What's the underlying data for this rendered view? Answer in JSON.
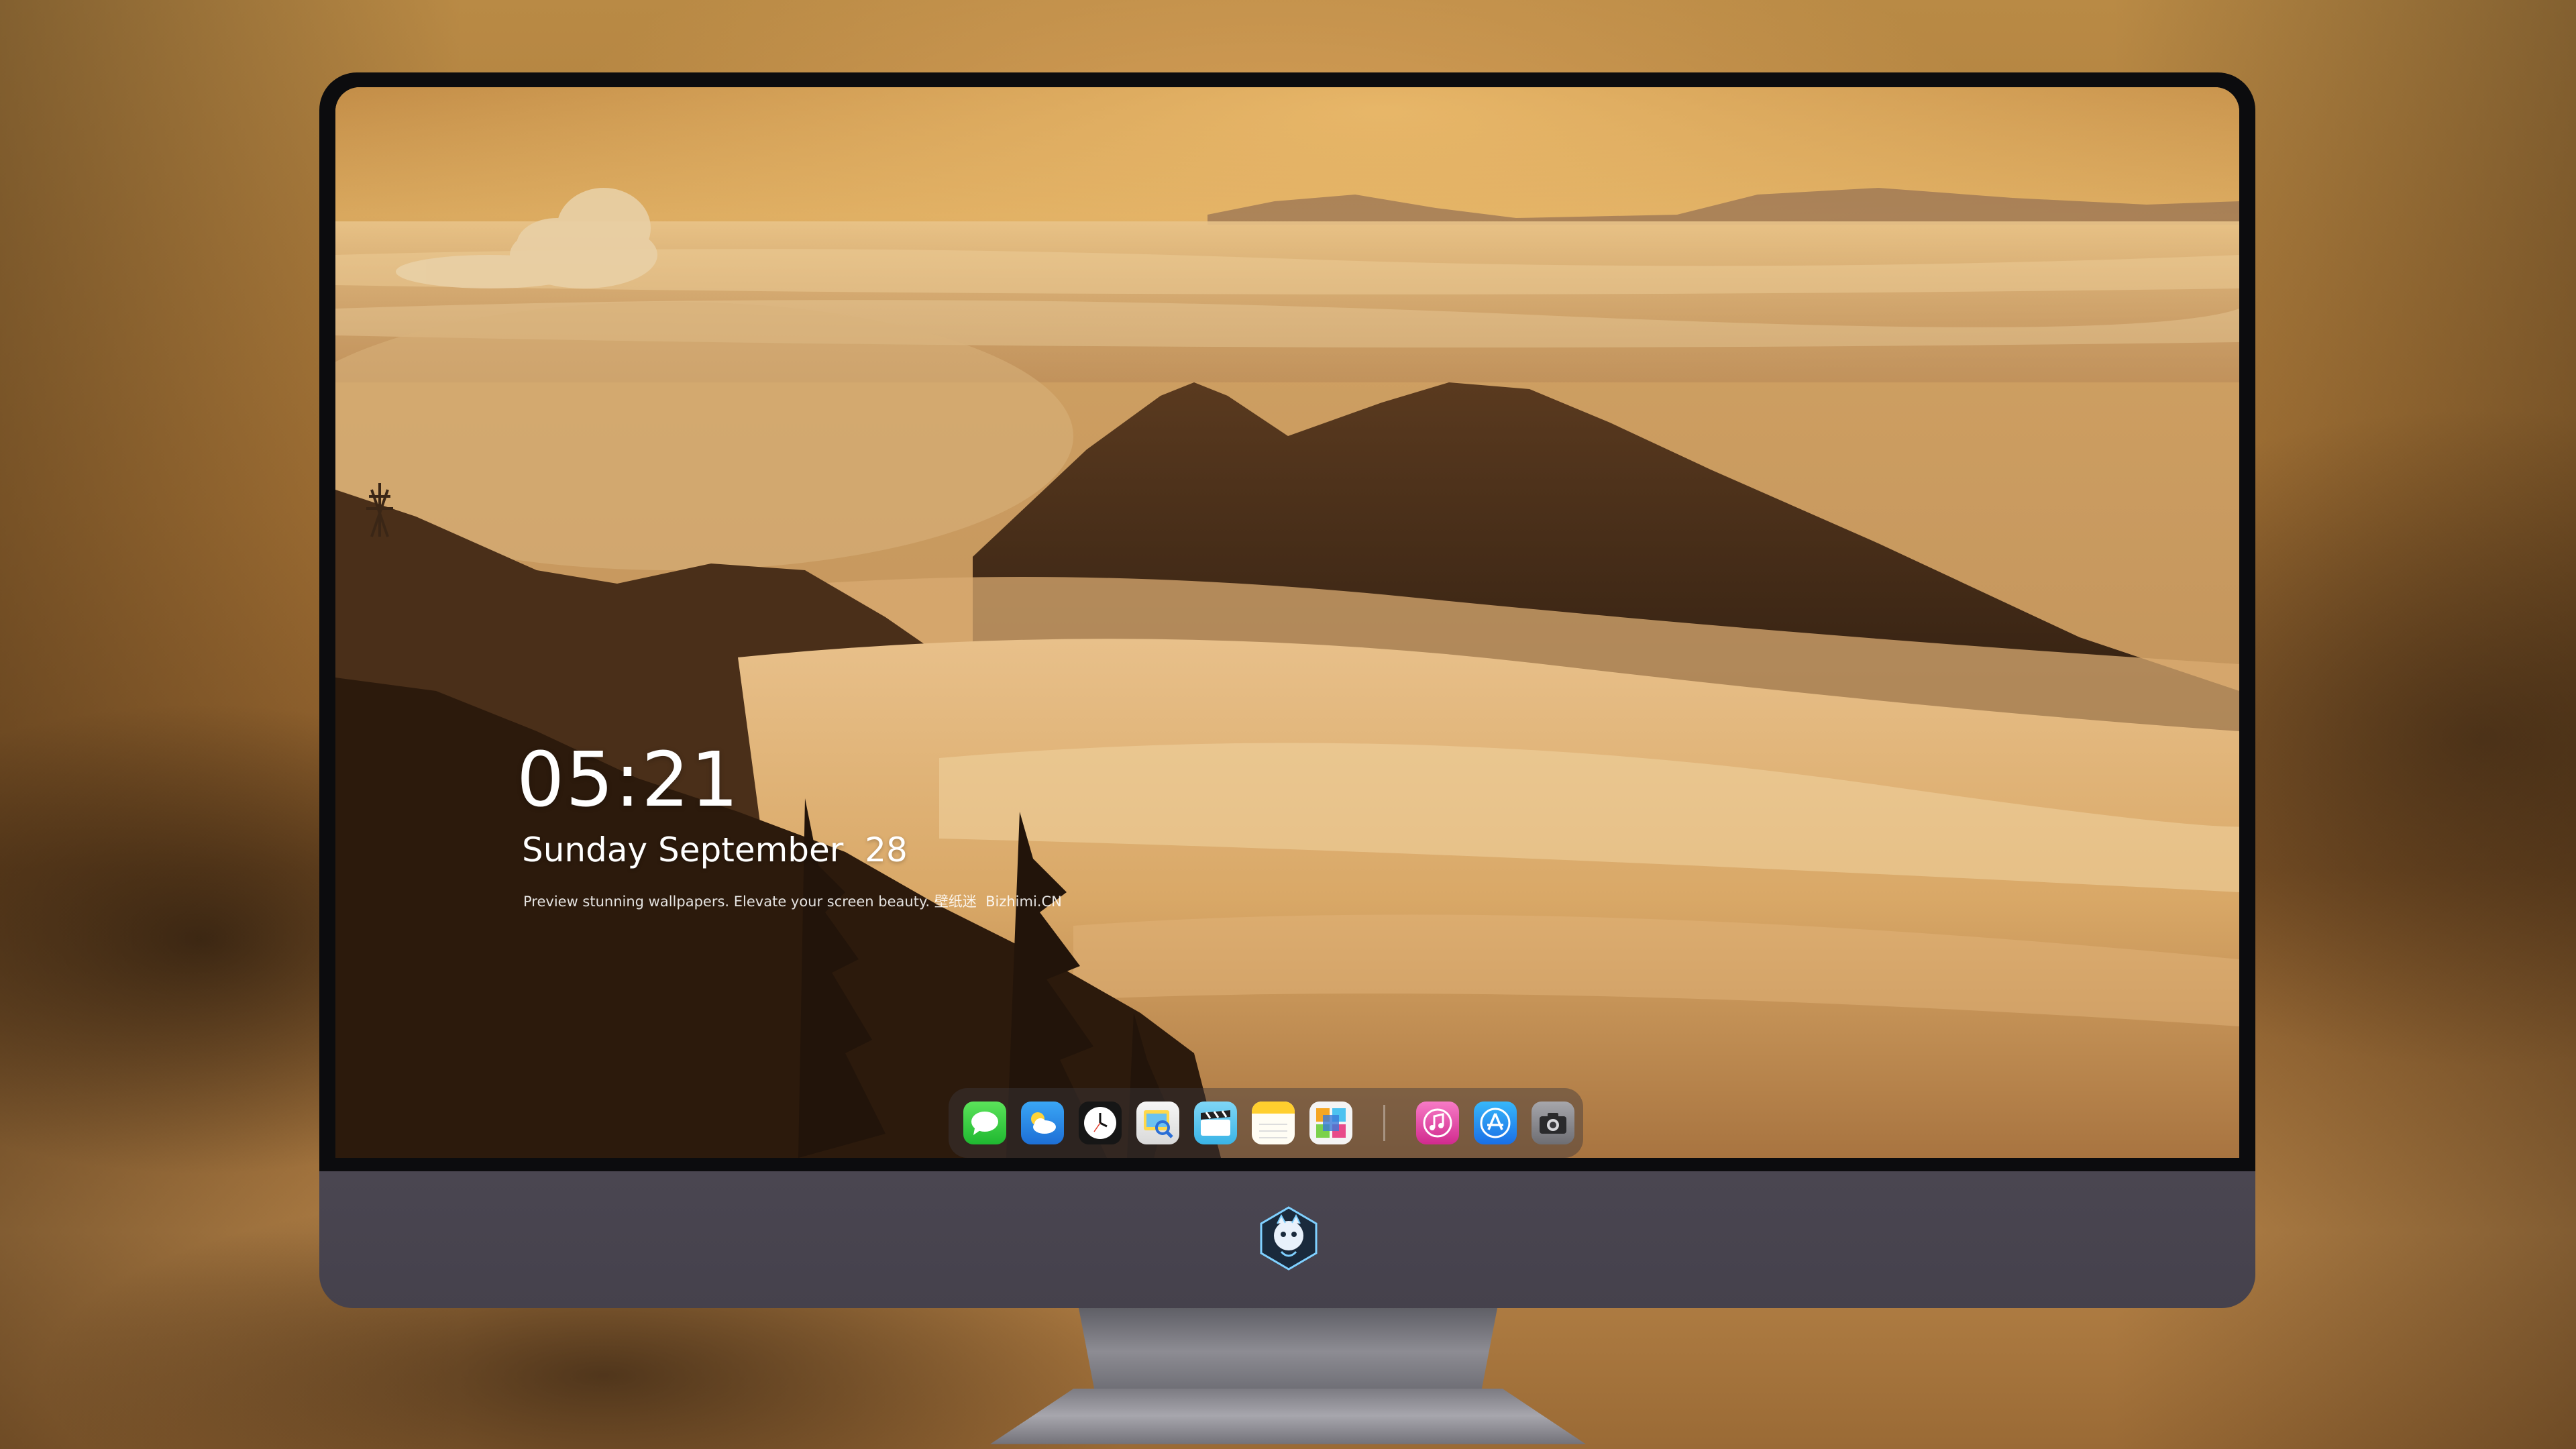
{
  "lock_screen": {
    "time": "05:21",
    "date": "Sunday September  28",
    "caption": "Preview stunning wallpapers. Elevate your screen beauty. 壁纸迷  Bizhimi.CN"
  },
  "dock": {
    "apps": [
      {
        "name": "messages-icon",
        "color": "#2ecc40"
      },
      {
        "name": "weather-icon",
        "color": "#2b8fe8"
      },
      {
        "name": "clock-icon",
        "color": "#111111"
      },
      {
        "name": "preview-icon",
        "color": "#f2f2f2"
      },
      {
        "name": "clips-icon",
        "color": "#5ec9f2"
      },
      {
        "name": "notes-icon",
        "color": "#ffd23d"
      },
      {
        "name": "photo-grid-icon",
        "color": "#f4f4f4"
      },
      {
        "name": "music-icon",
        "color": "#f03ca0"
      },
      {
        "name": "app-store-icon",
        "color": "#1e8cf0"
      },
      {
        "name": "camera-icon",
        "color": "#8a8a8f"
      }
    ]
  },
  "colors": {
    "bezel": "#0c0c0e",
    "chin": "#47434e",
    "sky_gold": "#d6a45a",
    "mountain_dark": "#3a2616"
  }
}
